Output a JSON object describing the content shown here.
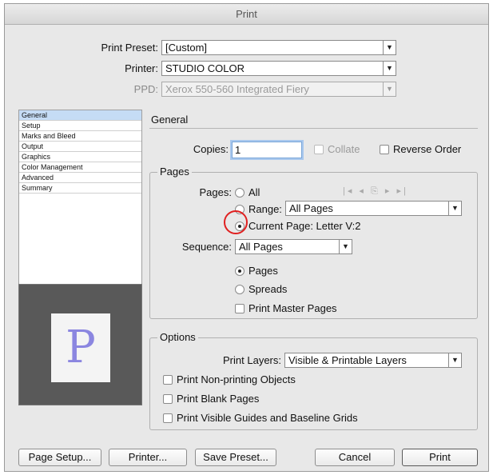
{
  "window": {
    "title": "Print"
  },
  "top": {
    "preset_label": "Print Preset:",
    "preset_value": "[Custom]",
    "printer_label": "Printer:",
    "printer_value": "STUDIO COLOR",
    "ppd_label": "PPD:",
    "ppd_value": "Xerox 550-560 Integrated Fiery"
  },
  "sidebar": {
    "items": [
      {
        "label": "General"
      },
      {
        "label": "Setup"
      },
      {
        "label": "Marks and Bleed"
      },
      {
        "label": "Output"
      },
      {
        "label": "Graphics"
      },
      {
        "label": "Color Management"
      },
      {
        "label": "Advanced"
      },
      {
        "label": "Summary"
      }
    ],
    "selected_index": 0
  },
  "preview": {
    "letter": "P"
  },
  "general": {
    "title": "General",
    "copies_label": "Copies:",
    "copies_value": "1",
    "collate_label": "Collate",
    "reverse_label": "Reverse Order"
  },
  "pages": {
    "group_label": "Pages",
    "pages_label": "Pages:",
    "all_label": "All",
    "nav_icons": "|◂ ◂ ⎘ ▸ ▸|",
    "range_label": "Range:",
    "range_value": "All Pages",
    "current_label": "Current Page: Letter V:2",
    "sequence_label": "Sequence:",
    "sequence_value": "All Pages",
    "pages_opt": "Pages",
    "spreads_opt": "Spreads",
    "master_label": "Print Master Pages"
  },
  "options": {
    "group_label": "Options",
    "layers_label": "Print Layers:",
    "layers_value": "Visible & Printable Layers",
    "nonprinting_label": "Print Non-printing Objects",
    "blank_label": "Print Blank Pages",
    "guides_label": "Print Visible Guides and Baseline Grids"
  },
  "buttons": {
    "page_setup": "Page Setup...",
    "printer": "Printer...",
    "save_preset": "Save Preset...",
    "cancel": "Cancel",
    "print": "Print"
  },
  "colors": {
    "annotation": "#e02020",
    "selection": "#c5dcf5",
    "preview_letter": "#8b86e0"
  }
}
